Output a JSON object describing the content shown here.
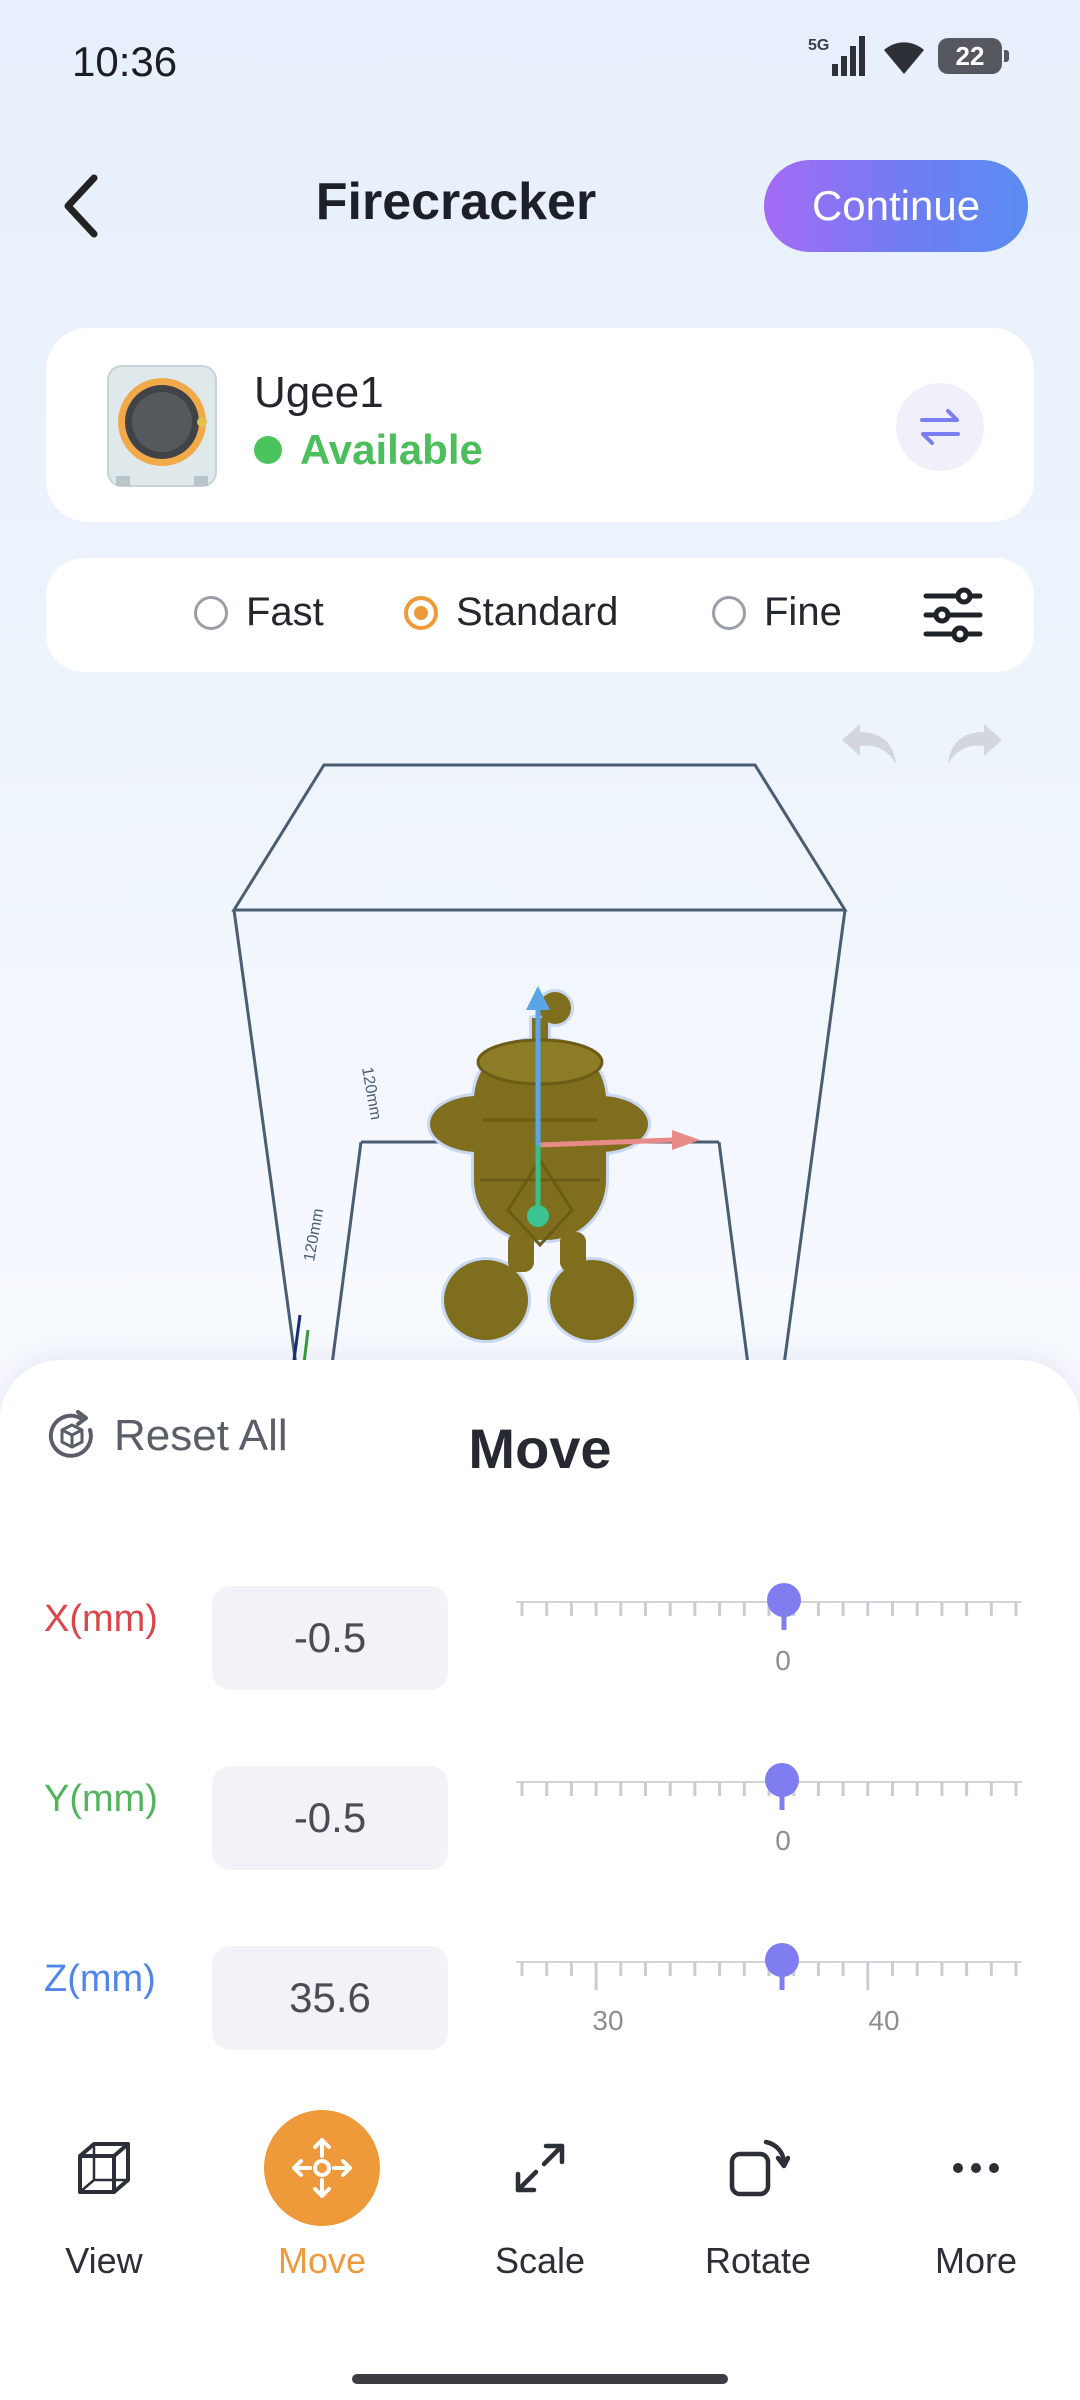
{
  "status_bar": {
    "time": "10:36",
    "network": "5G",
    "battery": "22"
  },
  "header": {
    "title": "Firecracker",
    "continue_label": "Continue"
  },
  "printer": {
    "name": "Ugee1",
    "status": "Available"
  },
  "quality": {
    "options": [
      "Fast",
      "Standard",
      "Fine"
    ],
    "selected": "Standard"
  },
  "viewport": {
    "dim_label_1": "120mm",
    "dim_label_2": "120mm"
  },
  "panel": {
    "reset_label": "Reset All",
    "title": "Move",
    "rows": [
      {
        "axis": "X(mm)",
        "value": "-0.5",
        "ticks": [
          "0"
        ],
        "color": "#d9474a"
      },
      {
        "axis": "Y(mm)",
        "value": "-0.5",
        "ticks": [
          "0"
        ],
        "color": "#52b45c"
      },
      {
        "axis": "Z(mm)",
        "value": "35.6",
        "ticks": [
          "30",
          "40"
        ],
        "color": "#4f86e8"
      }
    ]
  },
  "nav": {
    "items": [
      "View",
      "Move",
      "Scale",
      "Rotate",
      "More"
    ],
    "active": "Move"
  },
  "colors": {
    "accent": "#ef9a3a",
    "slider_thumb": "#7f7df0",
    "available": "#4cc45e"
  }
}
